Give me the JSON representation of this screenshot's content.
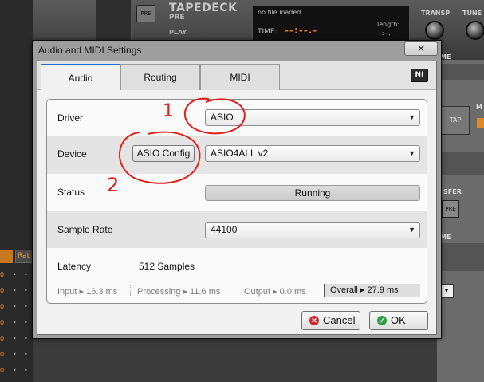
{
  "background": {
    "pre_label": "PRE",
    "title": "TAPEDECK",
    "subtitle": "PRE",
    "play_label": "PLAY",
    "display": {
      "file_status": "no file loaded",
      "time_label": "TIME:",
      "time_value": "--:--.-",
      "length_label": "length:",
      "length_value": "--:--.-"
    },
    "knobs": [
      "TRANSP",
      "TUNE"
    ],
    "right_labels": {
      "me_1": "ME",
      "tap": "TAP",
      "sfer": "SFER",
      "pre": "PRE",
      "me_2": "ME",
      "dropdown_arrow": "▾",
      "m": "M"
    },
    "rate_tab": "Rat"
  },
  "dialog": {
    "title": "Audio and MIDI Settings",
    "close_label": "✕",
    "logo_text": "NI",
    "tabs": [
      {
        "label": "Audio",
        "active": true
      },
      {
        "label": "Routing",
        "active": false
      },
      {
        "label": "MIDI",
        "active": false
      }
    ],
    "rows": {
      "driver": {
        "label": "Driver",
        "value": "ASIO"
      },
      "device": {
        "label": "Device",
        "button_label": "ASIO Config",
        "value": "ASIO4ALL v2"
      },
      "status": {
        "label": "Status",
        "value": "Running"
      },
      "sample_rate": {
        "label": "Sample Rate",
        "value": "44100"
      },
      "latency": {
        "label": "Latency",
        "value": "512 Samples"
      }
    },
    "latency_breakdown": {
      "input": "Input ▸ 16.3 ms",
      "processing": "Processing   ▸ 11.6 ms",
      "output": "Output ▸ 0.0 ms",
      "overall": "Overall   ▸ 27.9 ms"
    },
    "buttons": {
      "cancel": "Cancel",
      "ok": "OK"
    }
  },
  "annotations": {
    "mark_1": "1",
    "mark_2": "2",
    "color": "#e0201a"
  }
}
